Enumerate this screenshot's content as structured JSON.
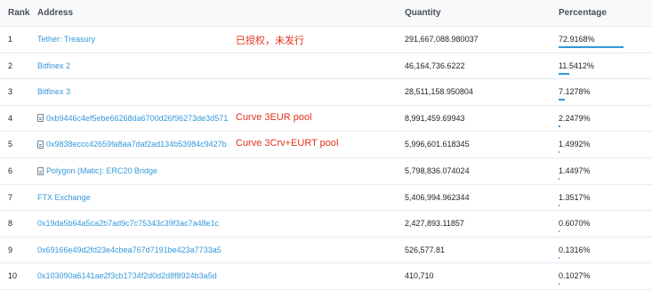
{
  "header": {
    "rank": "Rank",
    "address": "Address",
    "quantity": "Quantity",
    "percentage": "Percentage"
  },
  "rows": [
    {
      "rank": "1",
      "address": "Tether: Treasury",
      "contract": false,
      "quantity": "291,667,088.980037",
      "percentage": "72.9168%",
      "pct_value": 72.9168,
      "note": "已授权，未发行"
    },
    {
      "rank": "2",
      "address": "Bitfinex 2",
      "contract": false,
      "quantity": "46,164,736.6222",
      "percentage": "11.5412%",
      "pct_value": 11.5412,
      "note": ""
    },
    {
      "rank": "3",
      "address": "Bitfinex 3",
      "contract": false,
      "quantity": "28,511,158.950804",
      "percentage": "7.1278%",
      "pct_value": 7.1278,
      "note": ""
    },
    {
      "rank": "4",
      "address": "0xb9446c4ef5ebe66268da6700d26f96273de3d571",
      "contract": true,
      "quantity": "8,991,459.69943",
      "percentage": "2.2479%",
      "pct_value": 2.2479,
      "note": "Curve 3EUR pool"
    },
    {
      "rank": "5",
      "address": "0x9838eccc42659fa8aa7daf2ad134b53984c9427b",
      "contract": true,
      "quantity": "5,996,601.618345",
      "percentage": "1.4992%",
      "pct_value": 1.4992,
      "note": "Curve 3Crv+EURT pool"
    },
    {
      "rank": "6",
      "address": "Polygon (Matic): ERC20 Bridge",
      "contract": true,
      "quantity": "5,798,836.074024",
      "percentage": "1.4497%",
      "pct_value": 1.4497,
      "note": ""
    },
    {
      "rank": "7",
      "address": "FTX Exchange",
      "contract": false,
      "quantity": "5,406,994.962344",
      "percentage": "1.3517%",
      "pct_value": 1.3517,
      "note": ""
    },
    {
      "rank": "8",
      "address": "0x19da5b64a5ca2b7ad9c7c75343c39f3ac7a48e1c",
      "contract": false,
      "quantity": "2,427,893.11857",
      "percentage": "0.6070%",
      "pct_value": 0.607,
      "note": ""
    },
    {
      "rank": "9",
      "address": "0x69166e49d2fd23e4cbea767d7191be423a7733a5",
      "contract": false,
      "quantity": "526,577.81",
      "percentage": "0.1316%",
      "pct_value": 0.1316,
      "note": ""
    },
    {
      "rank": "10",
      "address": "0x103090a6141ae2f3cb1734f2d0d2d8f8924b3a5d",
      "contract": false,
      "quantity": "410,710",
      "percentage": "0.1027%",
      "pct_value": 0.1027,
      "note": ""
    }
  ],
  "colors": {
    "link": "#3498db",
    "note": "#e0341e",
    "bar": "#3498db"
  },
  "icons": {
    "contract": "file-document-icon"
  }
}
